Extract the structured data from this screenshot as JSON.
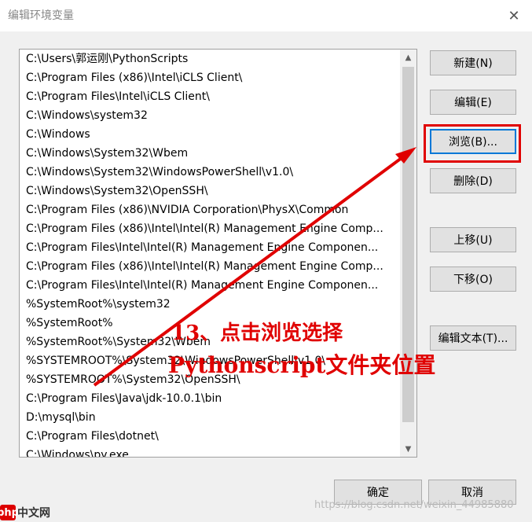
{
  "window": {
    "title": "编辑环境变量",
    "close_glyph": "✕"
  },
  "paths": [
    "C:\\Users\\郭运刚\\PythonScripts",
    "C:\\Program Files (x86)\\Intel\\iCLS Client\\",
    "C:\\Program Files\\Intel\\iCLS Client\\",
    "C:\\Windows\\system32",
    "C:\\Windows",
    "C:\\Windows\\System32\\Wbem",
    "C:\\Windows\\System32\\WindowsPowerShell\\v1.0\\",
    "C:\\Windows\\System32\\OpenSSH\\",
    "C:\\Program Files (x86)\\NVIDIA Corporation\\PhysX\\Common",
    "C:\\Program Files (x86)\\Intel\\Intel(R) Management Engine Comp...",
    "C:\\Program Files\\Intel\\Intel(R) Management Engine Componen...",
    "C:\\Program Files (x86)\\Intel\\Intel(R) Management Engine Comp...",
    "C:\\Program Files\\Intel\\Intel(R) Management Engine Componen...",
    "%SystemRoot%\\system32",
    "%SystemRoot%",
    "%SystemRoot%\\System32\\Wbem",
    "%SYSTEMROOT%\\System32\\WindowsPowerShell\\v1.0\\",
    "%SYSTEMROOT%\\System32\\OpenSSH\\",
    "C:\\Program Files\\Java\\jdk-10.0.1\\bin",
    "D:\\mysql\\bin",
    "C:\\Program Files\\dotnet\\",
    "C:\\Windows\\py.exe"
  ],
  "buttons": {
    "new": "新建(N)",
    "edit": "编辑(E)",
    "browse": "浏览(B)...",
    "delete": "删除(D)",
    "move_up": "上移(U)",
    "move_down": "下移(O)",
    "edit_text": "编辑文本(T)...",
    "ok": "确定",
    "cancel": "取消"
  },
  "annotation": {
    "line1": "13、点击浏览选择",
    "line2": "Pythonscript文件夹位置",
    "color": "#e00000"
  },
  "watermark": "https://blog.csdn.net/weixin_44985880",
  "logo": {
    "mark": "php",
    "text": "中文网"
  }
}
